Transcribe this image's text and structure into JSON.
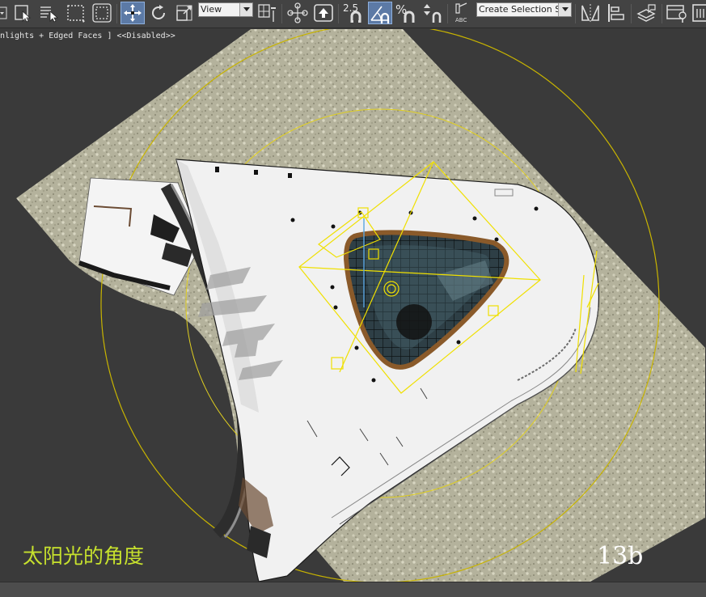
{
  "toolbar": {
    "ref_coord_value": "View",
    "selection_set_placeholder": "Create Selection Se",
    "snap_label": "2.5",
    "percent_snap_label": "%",
    "tools": [
      "select-filter-icon",
      "select-object-icon",
      "select-by-name-icon",
      "rectangular-selection-icon",
      "window-crossing-icon",
      "move-icon",
      "rotate-icon",
      "scale-icon",
      "reference-coordinate-system",
      "use-pivot-center-icon",
      "select-and-manipulate-icon",
      "keyboard-shortcut-override-icon",
      "snaps-toggle-icon",
      "angle-snap-icon",
      "percent-snap-icon",
      "spinner-snap-icon",
      "edit-named-selection-icon",
      "named-selection-sets",
      "mirror-icon",
      "align-icon",
      "layer-manager-icon",
      "scene-explorer-icon",
      "ribbon-icon"
    ]
  },
  "viewport": {
    "label": "nlights + Edged Faces ] <<Disabled>>"
  },
  "captions": {
    "title_cn": "太阳光的角度",
    "figure_no": "13b"
  },
  "colors": {
    "ui_bg": "#434343",
    "viewport_bg": "#3a3a3a",
    "caption_green": "#c7e12d",
    "light_yellow": "#f0e000",
    "selection_orange": "#f2a200"
  }
}
